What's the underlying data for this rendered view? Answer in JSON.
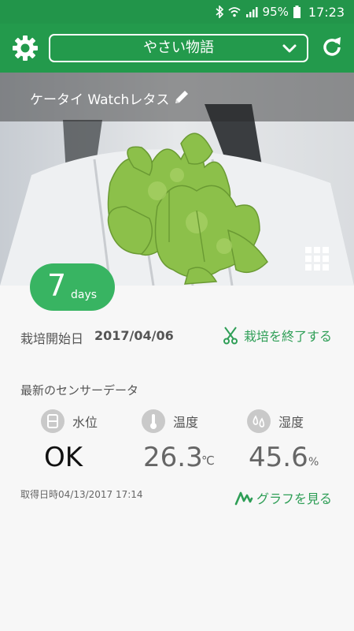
{
  "status_bar": {
    "battery": "95%",
    "time": "17:23"
  },
  "app_bar": {
    "selector_value": "やさい物語"
  },
  "photo": {
    "plant_name": "ケータイ Watchレタス"
  },
  "badge": {
    "days_number": "7",
    "days_unit": "days"
  },
  "cultivation": {
    "start_label": "栽培開始日",
    "start_date": "2017/04/06",
    "end_label": "栽培を終了する"
  },
  "sensors": {
    "section_title": "最新のセンサーデータ",
    "water": {
      "label": "水位",
      "value": "OK"
    },
    "temperature": {
      "label": "温度",
      "value": "26.3",
      "unit": "℃"
    },
    "humidity": {
      "label": "湿度",
      "value": "45.6",
      "unit": "%"
    },
    "acquired": "取得日時04/13/2017 17:14",
    "graph_label": "グラフを見る"
  },
  "colors": {
    "primary": "#239a4c",
    "badge": "#38b462",
    "link": "#2e9e56"
  }
}
